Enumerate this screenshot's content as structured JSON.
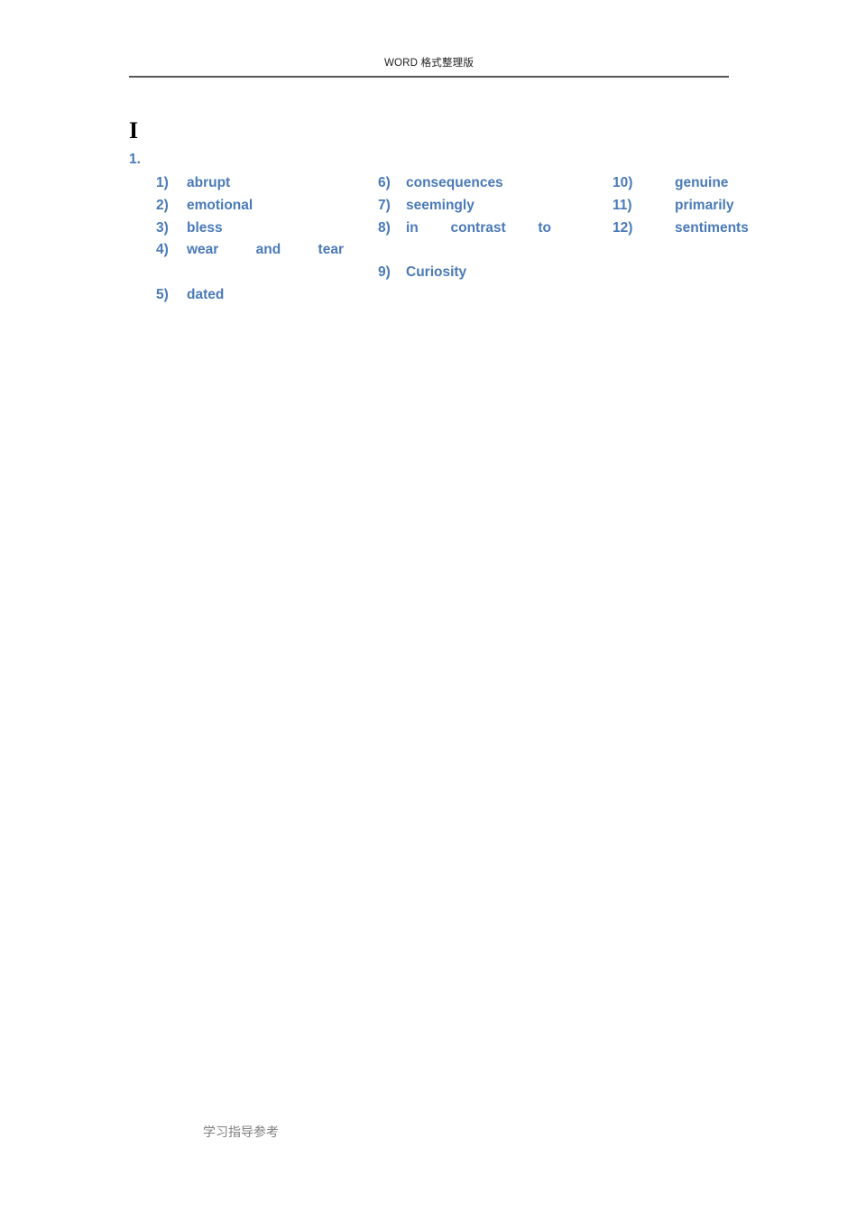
{
  "header": {
    "text": "WORD 格式整理版"
  },
  "body": {
    "section_title": "I",
    "question_number": "1."
  },
  "answers": {
    "column_1": [
      {
        "marker": "1)",
        "text": "abrupt"
      },
      {
        "marker": "2)",
        "text": "emotional"
      },
      {
        "marker": "3)",
        "text": "bless"
      },
      {
        "marker": "4)",
        "text": "wear and tear"
      },
      {
        "marker": "5)",
        "text": "dated"
      }
    ],
    "column_2": [
      {
        "marker": "6)",
        "text": "consequences"
      },
      {
        "marker": "7)",
        "text": "seemingly"
      },
      {
        "marker": "8)",
        "text": "in contrast to"
      },
      {
        "marker": "9)",
        "text": "Curiosity"
      }
    ],
    "column_3": [
      {
        "marker": "10)",
        "text": "genuine"
      },
      {
        "marker": "11)",
        "text": "primarily"
      },
      {
        "marker": "12)",
        "text": "sentiments"
      }
    ]
  },
  "footer": {
    "text": "学习指导参考"
  },
  "colors": {
    "answer_blue": "#4A7AB8",
    "heading_black": "#000000",
    "rule_gray": "#575757",
    "footer_gray": "#808080",
    "page_background": "#FFFFFF"
  }
}
